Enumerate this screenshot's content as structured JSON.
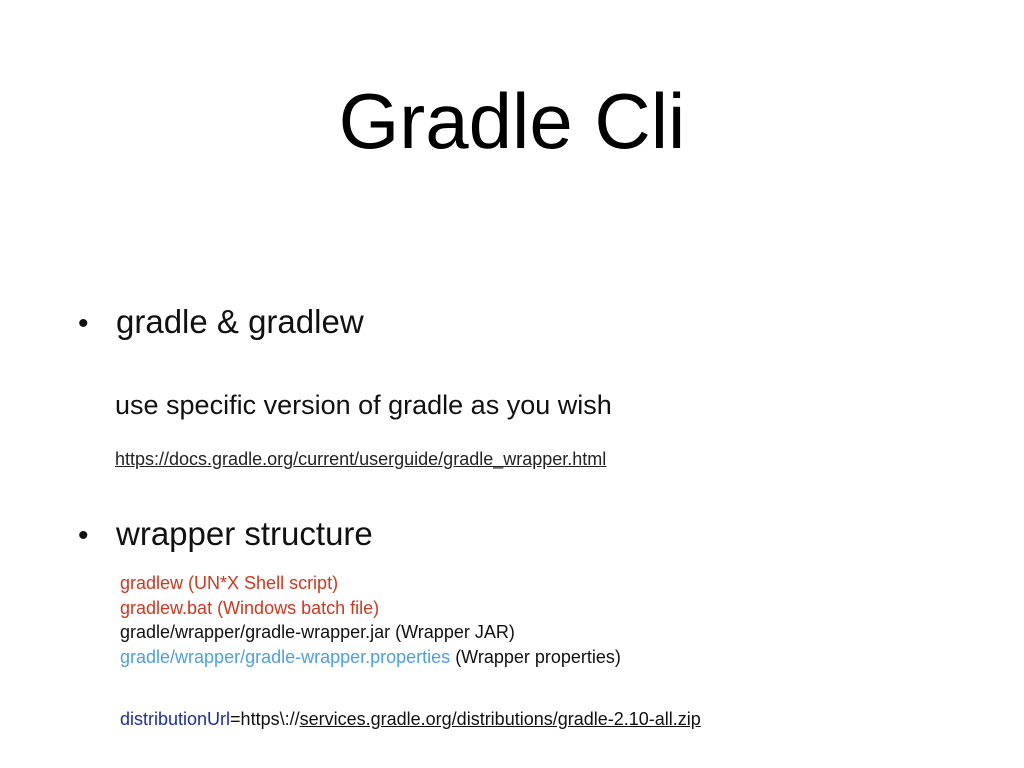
{
  "slide": {
    "title": "Gradle Cli",
    "bullet_symbol": "•",
    "bullets": [
      {
        "label": "gradle & gradlew",
        "description": "use specific version of gradle as you wish",
        "link": "https://docs.gradle.org/current/userguide/gradle_wrapper.html"
      },
      {
        "label": "wrapper structure"
      }
    ],
    "files": [
      {
        "text": "gradlew (UN*X Shell script)"
      },
      {
        "text": "gradlew.bat (Windows batch file)"
      },
      {
        "text": "gradle/wrapper/gradle-wrapper.jar (Wrapper JAR)"
      },
      {
        "path": "gradle/wrapper/gradle-wrapper.properties",
        "suffix": " (Wrapper properties)"
      }
    ],
    "distribution": {
      "key": "distributionUrl",
      "equals": "=https\\:",
      "slashes": "//",
      "url": "services.gradle.org/distributions/gradle-2.10-all.zip"
    }
  },
  "colors": {
    "red": "#d0371f",
    "light_blue": "#4e9fe0",
    "dark_blue": "#1c2f9c",
    "text": "#111111",
    "background": "#ffffff"
  }
}
